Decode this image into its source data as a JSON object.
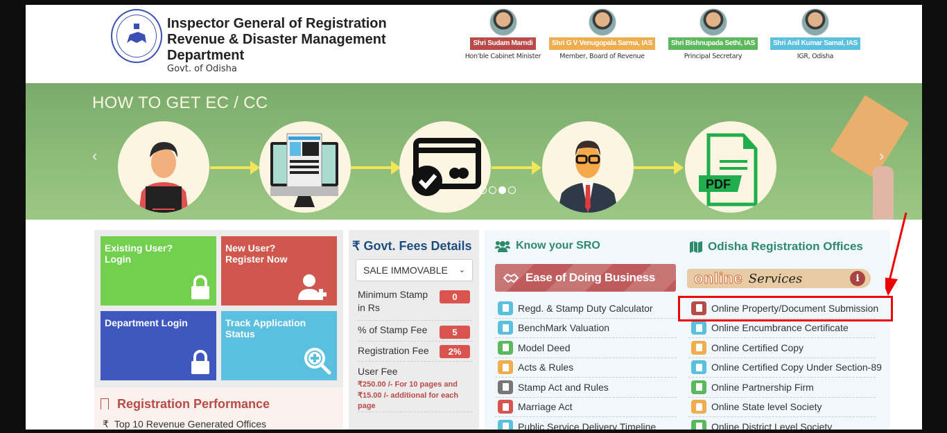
{
  "header": {
    "title_lines": [
      "Inspector General of Registration",
      "Revenue & Disaster Management",
      "Department"
    ],
    "subtitle": "Govt. of Odisha",
    "logo": "odisha-emblem-logo",
    "officials": [
      {
        "name": "Shri Sudam Marndi",
        "role": "Hon'ble Cabinet Minister",
        "color": "#b94a48"
      },
      {
        "name": "Shri G V Venugopala Sarma, IAS",
        "role": "Member, Board of Revenue",
        "color": "#f0ad4e"
      },
      {
        "name": "Shri Bishnupada Sethi, IAS",
        "role": "Principal Secretary",
        "color": "#5cb85c"
      },
      {
        "name": "Shri Anil Kumar Samal, IAS",
        "role": "IGR, Odisha",
        "color": "#5bc0de"
      }
    ]
  },
  "banner": {
    "title": "HOW TO GET EC / CC",
    "prev": "‹",
    "next": "›",
    "slides_total": 4,
    "active_slide": 3,
    "steps": [
      "user-with-laptop",
      "online-form",
      "payment-card",
      "officer",
      "pdf-document"
    ],
    "pdf_label": "PDF"
  },
  "tiles": [
    {
      "label_line1": "Existing User?",
      "label_line2": "Login",
      "icon": "lock-icon",
      "color": "#72d04e"
    },
    {
      "label_line1": "New User?",
      "label_line2": "Register Now",
      "icon": "user-plus-icon",
      "color": "#d0574e"
    },
    {
      "label_line1": "Department Login",
      "label_line2": "",
      "icon": "lock-icon",
      "color": "#3f58c0"
    },
    {
      "label_line1": "Track Application",
      "label_line2": "Status",
      "icon": "search-plus-icon",
      "color": "#5bbfdf"
    }
  ],
  "performance": {
    "title": "Registration Performance",
    "item": "Top 10 Revenue Generated Offices",
    "item_icon": "₹"
  },
  "fees": {
    "title": "₹ Govt. Fees Details",
    "select_value": "SALE IMMOVABLE",
    "rows": [
      {
        "label": "Minimum Stamp in Rs",
        "value": "0"
      },
      {
        "label": "% of Stamp Fee",
        "value": "5"
      },
      {
        "label": "Registration Fee",
        "value": "2%"
      }
    ],
    "user_fee_label": "User Fee",
    "user_fee_note": "₹250.00 /-  For 10 pages and ₹15.00 /- additional  for each page"
  },
  "sro": {
    "title": "Know your SRO",
    "ease_banner": "Ease of Doing Business",
    "items": [
      {
        "label": "Regd. & Stamp Duty Calculator",
        "icon": "calculator-icon",
        "color": "#5bc0de"
      },
      {
        "label": "BenchMark Valuation",
        "icon": "calculator-icon",
        "color": "#5bc0de"
      },
      {
        "label": "Model Deed",
        "icon": "document-icon",
        "color": "#5cb85c"
      },
      {
        "label": "Acts & Rules",
        "icon": "book-icon",
        "color": "#f0ad4e"
      },
      {
        "label": "Stamp Act and Rules",
        "icon": "book-icon",
        "color": "#777777"
      },
      {
        "label": " Marriage Act",
        "icon": "book-icon",
        "color": "#d9534f"
      },
      {
        "label": "Public Service Delivery Timeline",
        "icon": "hourglass-icon",
        "color": "#5bc0de"
      }
    ]
  },
  "offices": {
    "title": "Odisha Registration Offices",
    "online_word": "online",
    "services_word": "Services",
    "items": [
      {
        "label": "Online Property/Document Submission",
        "color": "#b94a48"
      },
      {
        "label": "Online Encumbrance Certificate",
        "color": "#5bc0de"
      },
      {
        "label": "Online Certified Copy",
        "color": "#f0ad4e"
      },
      {
        "label": "Online Certified Copy Under Section-89",
        "color": "#5bc0de"
      },
      {
        "label": "Online Partnership Firm",
        "color": "#5cb85c"
      },
      {
        "label": "Online State level Society",
        "color": "#f0ad4e"
      },
      {
        "label": "Online District Level Society",
        "color": "#5cb85c"
      }
    ]
  },
  "annotation": {
    "highlighted_item": "Online Property/Document Submission",
    "color": "#ee0000"
  }
}
